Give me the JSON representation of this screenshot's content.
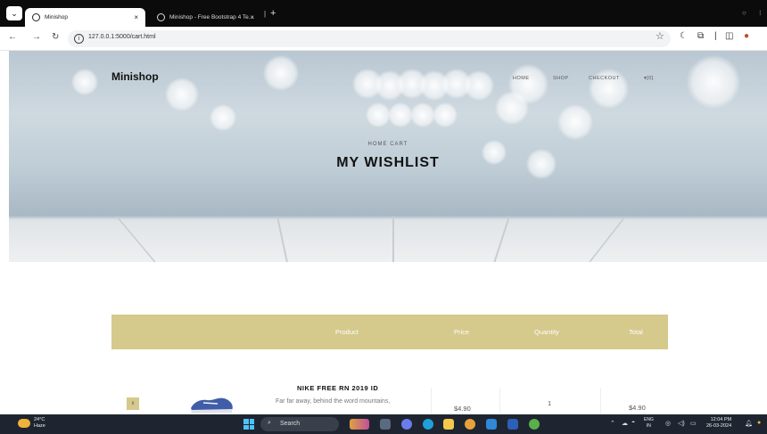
{
  "browser": {
    "tabs": [
      {
        "title": "Minishop",
        "close": "×"
      },
      {
        "title": "Minishop - Free Bootstrap 4 Te...",
        "close": "×"
      }
    ],
    "new_tab": "+",
    "url": "127.0.0.1:5000/cart.html",
    "profile_glyph": "⌄",
    "icons": [
      "back-icon",
      "forward-icon",
      "reload-icon",
      "info-icon",
      "star-icon",
      "moon-icon",
      "extensions-icon",
      "sidebar-icon",
      "profile-avatar-icon"
    ]
  },
  "site": {
    "brand": "Minishop",
    "menu": {
      "home": "HOME",
      "shop": "SHOP",
      "checkout": "CHECKOUT",
      "cart": "[0]"
    },
    "breadcrumb": "HOME  CART",
    "title": "MY WISHLIST"
  },
  "table": {
    "header_color": "#d5c98c",
    "headers": {
      "product": "Product",
      "price": "Price",
      "quantity": "Quantity",
      "total": "Total"
    },
    "rows": [
      {
        "remove": "x",
        "name": "NIKE FREE RN 2019 ID",
        "description": "Far far away, behind the word mountains,",
        "price": "$4.90",
        "quantity": "1",
        "total": "$4.90"
      }
    ]
  },
  "taskbar": {
    "weather_temp": "24°C",
    "weather_desc": "Haze",
    "search_label": "Search",
    "lang_line1": "ENG",
    "lang_line2": "IN",
    "time": "12:04 PM",
    "date": "26-03-2024"
  }
}
